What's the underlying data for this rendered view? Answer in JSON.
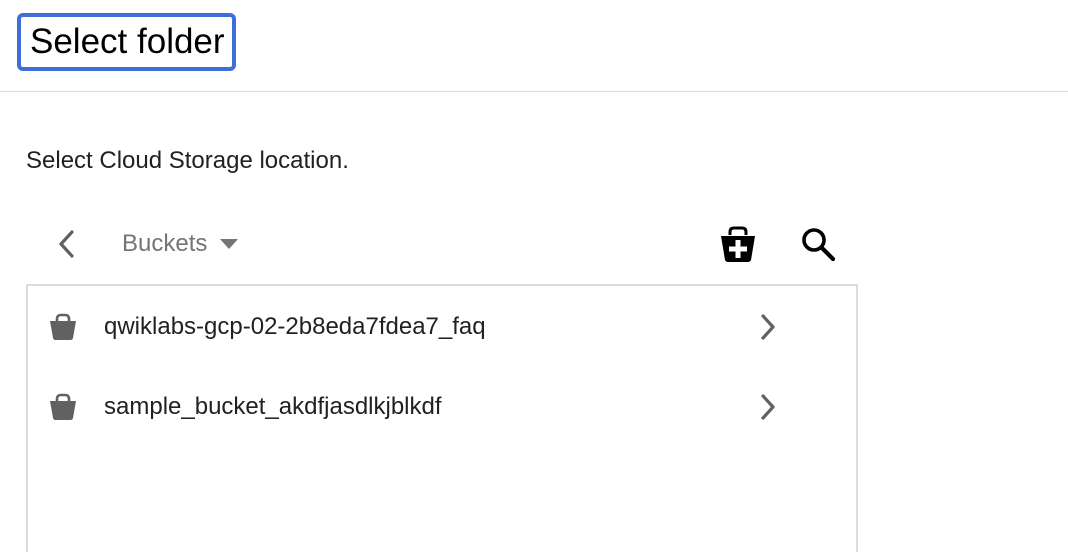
{
  "dialog": {
    "title": "Select folder",
    "subtitle": "Select Cloud Storage location."
  },
  "toolbar": {
    "back_icon": "chevron-left-icon",
    "breadcrumb_label": "Buckets",
    "breadcrumb_caret_icon": "caret-down-icon",
    "new_bucket_icon": "bucket-plus-icon",
    "search_icon": "search-icon"
  },
  "buckets": [
    {
      "name": "qwiklabs-gcp-02-2b8eda7fdea7_faq",
      "icon": "bucket-icon",
      "chevron": "chevron-right-icon"
    },
    {
      "name": "sample_bucket_akdfjasdlkjblkdf",
      "icon": "bucket-icon",
      "chevron": "chevron-right-icon"
    }
  ],
  "colors": {
    "focus_border": "#3c6fd9",
    "icon_dark": "#616161",
    "divider": "#dadce0",
    "muted_text": "#757575"
  }
}
